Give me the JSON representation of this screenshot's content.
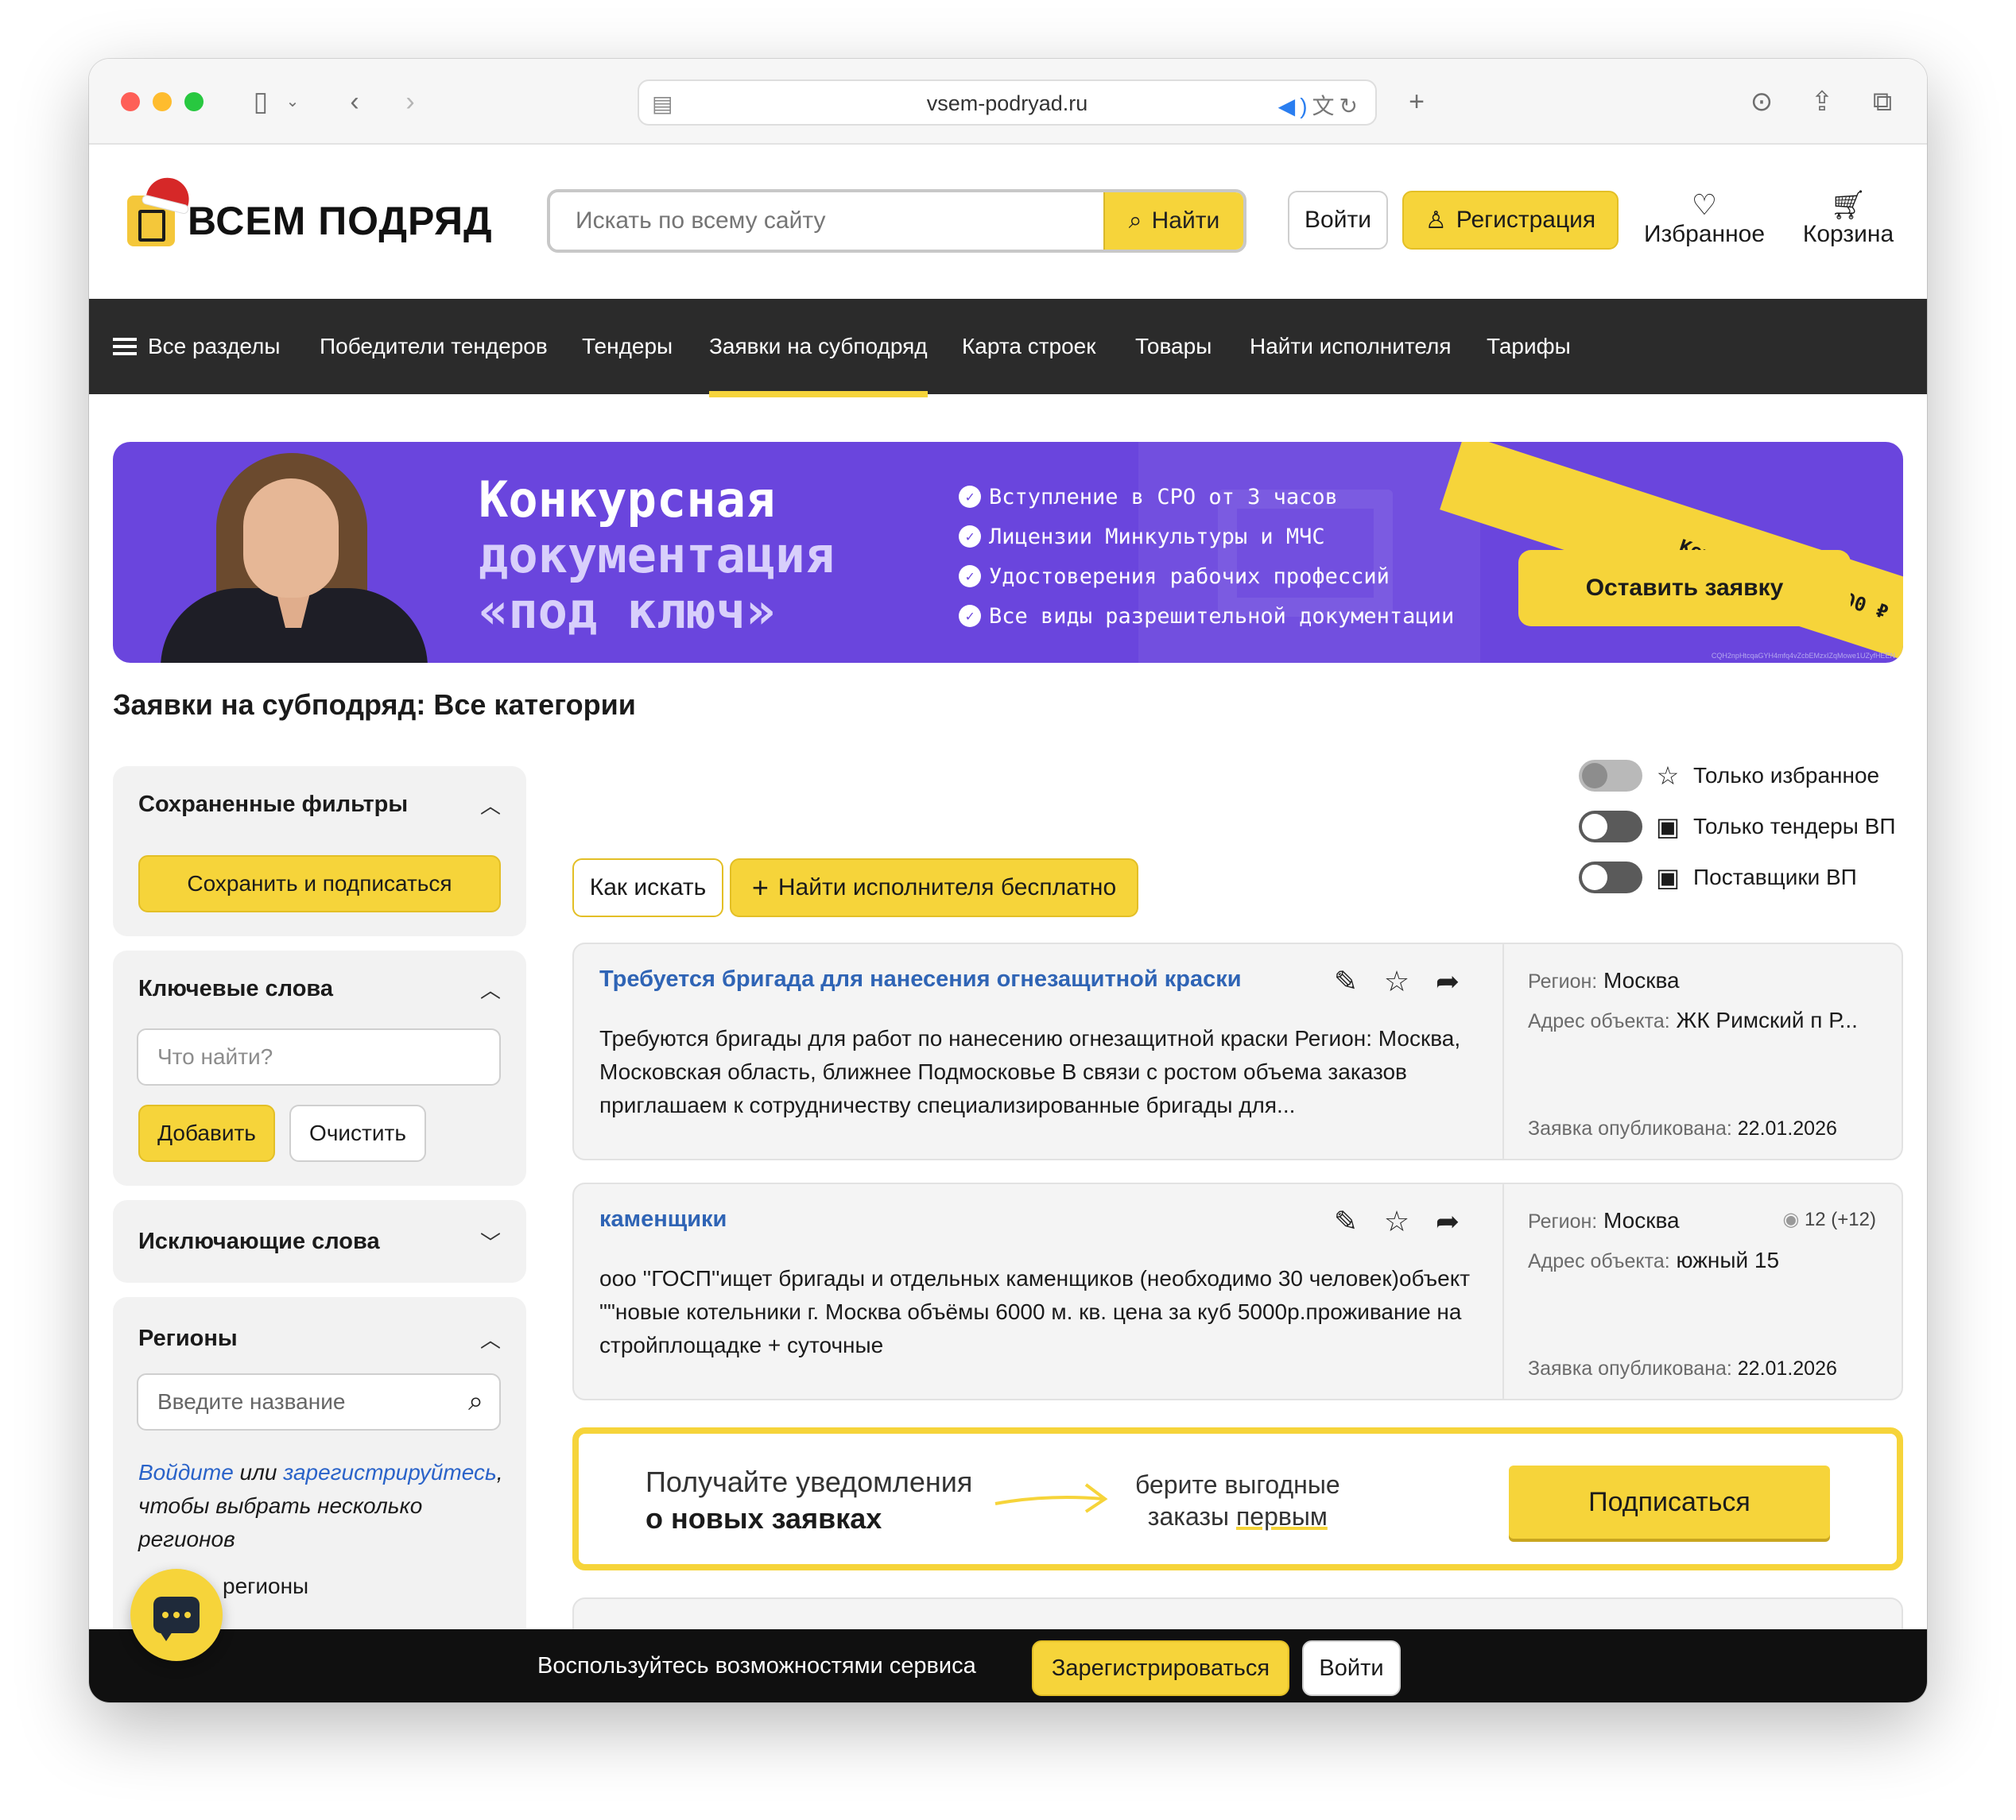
{
  "browser": {
    "url": "vsem-podryad.ru",
    "icons": [
      "sidebar-icon",
      "back-icon",
      "forward-icon",
      "audio-icon",
      "translate-icon",
      "reload-icon",
      "new-tab-icon",
      "downloads-icon",
      "share-icon",
      "tabs-overview-icon"
    ]
  },
  "header": {
    "logo_text": "ВСЕМ ПОДРЯД",
    "search_placeholder": "Искать по всему сайту",
    "search_button": "Найти",
    "login": "Войти",
    "register": "Регистрация",
    "favorites": "Избранное",
    "cart": "Корзина"
  },
  "nav": {
    "items": [
      "Все разделы",
      "Победители тендеров",
      "Тендеры",
      "Заявки на субподряд",
      "Карта строек",
      "Товары",
      "Найти исполнителя",
      "Тарифы"
    ],
    "active": "Заявки на субподряд"
  },
  "banner": {
    "title_line1": "Конкурсная",
    "title_line2": "документация",
    "title_line3": "«под ключ»",
    "bullets": [
      "Вступление в СРО от 3 часов",
      "Лицензии Минкультуры и МЧС",
      "Удостоверения рабочих профессий",
      "Все виды разрешительной документации"
    ],
    "ribbon": "Кешбэк: до 20 000 ₽",
    "cta": "Оставить заявку",
    "fine_print": "CQH2npHtcqaGYH4mfq4vZcbEMzxIZqMowe1UZyfHEEN"
  },
  "page_title": "Заявки на субподряд: Все категории",
  "sidebar": {
    "saved_filters": {
      "title": "Сохраненные фильтры",
      "button": "Сохранить и подписаться"
    },
    "keywords": {
      "title": "Ключевые слова",
      "placeholder": "Что найти?",
      "add": "Добавить",
      "clear": "Очистить"
    },
    "exclude": {
      "title": "Исключающие слова"
    },
    "regions": {
      "title": "Регионы",
      "placeholder": "Введите название",
      "hint_login": "Войдите",
      "hint_or": " или ",
      "hint_register": "зарегистрируйтесь",
      "hint_rest": ", чтобы выбрать несколько регионов",
      "partial": "регионы"
    }
  },
  "toggles": [
    {
      "label": "Только избранное",
      "icon": "star-icon",
      "state": "disabled"
    },
    {
      "label": "Только тендеры ВП",
      "icon": "logo-icon",
      "state": "off"
    },
    {
      "label": "Поставщики ВП",
      "icon": "logo-icon",
      "state": "off"
    }
  ],
  "actions": {
    "how_to_search": "Как искать",
    "find_executor": "Найти исполнителя бесплатно"
  },
  "listings": [
    {
      "title": "Требуется бригада для нанесения огнезащитной краски",
      "description": "Требуются бригады для работ по нанесению огнезащитной краски Регион: Москва, Московская область, ближнее Подмосковье В связи с ростом объема заказов приглашаем к сотрудничеству специализированные бригады для...",
      "region_label": "Регион:",
      "region": "Москва",
      "address_label": "Адрес объекта:",
      "address": "ЖК Римский п Р...",
      "published_label": "Заявка опубликована:",
      "published": "22.01.2026",
      "views": ""
    },
    {
      "title": "каменщики",
      "description": "ооо ''ГОСП''ищет бригады и отдельных каменщиков (необходимо 30 человек)объект \"\"новые котельники г. Москва объёмы 6000 м. кв. цена за куб 5000р.проживание на стройплощадке + суточные",
      "region_label": "Регион:",
      "region": "Москва",
      "address_label": "Адрес объекта:",
      "address": "южный 15",
      "published_label": "Заявка опубликована:",
      "published": "22.01.2026",
      "views": "12 (+12)"
    }
  ],
  "subscribe": {
    "line1": "Получайте уведомления",
    "line2": "о новых заявках",
    "mid_line1": "берите выгодные",
    "mid_line2_a": "заказы ",
    "mid_line2_b": "первым",
    "button": "Подписаться"
  },
  "bottom_bar": {
    "text": "Воспользуйтесь возможностями сервиса",
    "register": "Зарегистрироваться",
    "login": "Войти"
  },
  "colors": {
    "accent": "#f6d43a",
    "nav_bg": "#2b2b2b",
    "banner_bg": "#6a45dd",
    "link": "#2f64b5"
  }
}
